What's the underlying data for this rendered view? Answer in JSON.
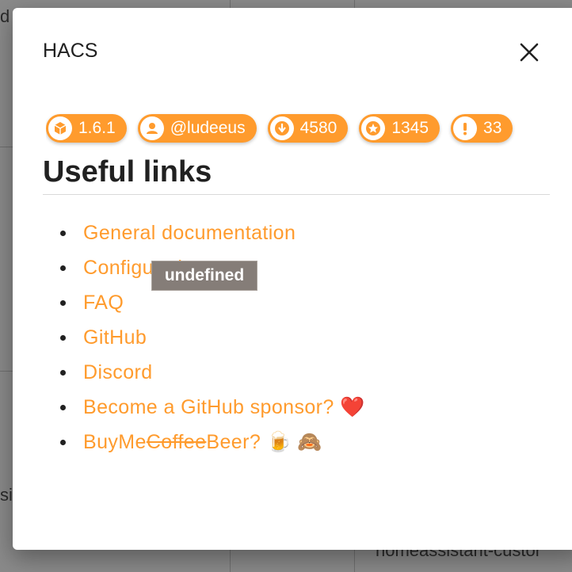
{
  "background": {
    "fragment_top_left": "d",
    "fragment_bottom_left": "si",
    "fragment_bottom_right": "homeassistant-custor"
  },
  "dialog": {
    "title": "HACS",
    "close_icon": "close-icon",
    "badges": [
      {
        "icon": "package-icon",
        "label": "1.6.1"
      },
      {
        "icon": "account-icon",
        "label": "@ludeeus"
      },
      {
        "icon": "download-icon",
        "label": "4580"
      },
      {
        "icon": "star-icon",
        "label": "1345"
      },
      {
        "icon": "alert-icon",
        "label": "33"
      }
    ],
    "section_heading": "Useful links",
    "links": {
      "general_documentation": "General documentation",
      "configuration": "Configuration",
      "faq": "FAQ",
      "github": "GitHub",
      "discord": "Discord",
      "sponsor": "Become a GitHub sponsor?",
      "sponsor_emoji": "❤️",
      "buymebeer_prefix": "BuyMe",
      "buymebeer_struck": "Coffee",
      "buymebeer_suffix": "Beer?",
      "buymebeer_emoji": "🍺 🙈"
    },
    "tooltip": "undefined"
  },
  "colors": {
    "accent": "#ff9b2d",
    "badge_text": "#ffffff",
    "tooltip_bg": "#857d78"
  }
}
